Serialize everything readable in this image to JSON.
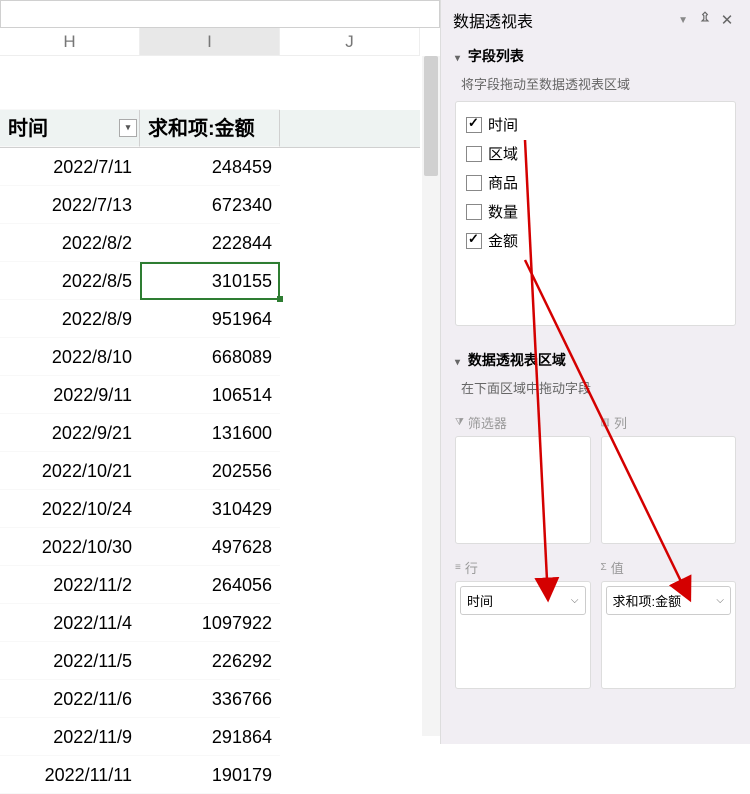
{
  "columns": [
    "H",
    "I",
    "J"
  ],
  "pivot_table": {
    "headers": {
      "row_label": "时间",
      "value_label": "求和项:金额"
    },
    "rows": [
      {
        "date": "2022/7/11",
        "value": "248459"
      },
      {
        "date": "2022/7/13",
        "value": "672340"
      },
      {
        "date": "2022/8/2",
        "value": "222844"
      },
      {
        "date": "2022/8/5",
        "value": "310155"
      },
      {
        "date": "2022/8/9",
        "value": "951964"
      },
      {
        "date": "2022/8/10",
        "value": "668089"
      },
      {
        "date": "2022/9/11",
        "value": "106514"
      },
      {
        "date": "2022/9/21",
        "value": "131600"
      },
      {
        "date": "2022/10/21",
        "value": "202556"
      },
      {
        "date": "2022/10/24",
        "value": "310429"
      },
      {
        "date": "2022/10/30",
        "value": "497628"
      },
      {
        "date": "2022/11/2",
        "value": "264056"
      },
      {
        "date": "2022/11/4",
        "value": "1097922"
      },
      {
        "date": "2022/11/5",
        "value": "226292"
      },
      {
        "date": "2022/11/6",
        "value": "336766"
      },
      {
        "date": "2022/11/9",
        "value": "291864"
      },
      {
        "date": "2022/11/11",
        "value": "190179"
      }
    ],
    "selected_row_index": 3
  },
  "panel": {
    "title": "数据透视表",
    "field_list_title": "字段列表",
    "field_list_hint": "将字段拖动至数据透视表区域",
    "fields": [
      {
        "name": "时间",
        "checked": true
      },
      {
        "name": "区域",
        "checked": false
      },
      {
        "name": "商品",
        "checked": false
      },
      {
        "name": "数量",
        "checked": false
      },
      {
        "name": "金额",
        "checked": true
      }
    ],
    "area_title": "数据透视表区域",
    "area_hint": "在下面区域中拖动字段",
    "areas": {
      "filter_label": "筛选器",
      "column_label": "列",
      "row_label": "行",
      "value_label": "值",
      "row_chip": "时间",
      "value_chip": "求和项:金额"
    }
  }
}
